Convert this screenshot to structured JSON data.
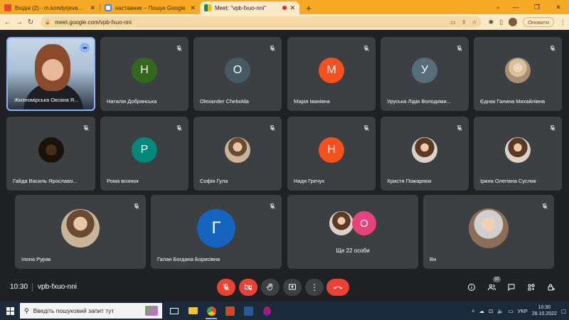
{
  "browser": {
    "tabs": [
      {
        "label": "Вхідні (2) - m.kondyrjeva@ippo.kubg...",
        "favicon_color": "#ea4335",
        "active": false
      },
      {
        "label": "наставник – Пошук Google",
        "favicon_color": "#4285f4",
        "active": false
      },
      {
        "label": "Meet: \"vpb-fxuo-nni\"",
        "favicon_color": "#00897b",
        "active": true
      }
    ],
    "url": "meet.google.com/vpb-fxuo-nni",
    "update_label": "Оновити",
    "theme_color": "#f6a925"
  },
  "meet": {
    "self_tile": {
      "name": "Жизномірська Оксана Я..."
    },
    "participants": [
      {
        "name": "Наталія Добрянська",
        "initial": "Н",
        "color": "#33691e",
        "kind": "letter"
      },
      {
        "name": "Olexander Chebolda",
        "initial": "O",
        "color": "#455a64",
        "kind": "letter"
      },
      {
        "name": "Марія Іванівна",
        "initial": "М",
        "color": "#f4511e",
        "kind": "letter"
      },
      {
        "name": "Уруська Лідія Володими...",
        "initial": "У",
        "color": "#546e7a",
        "kind": "letter"
      },
      {
        "name": "Єднак Галина Михайлівна",
        "initial": "",
        "color": "",
        "kind": "photo2"
      },
      {
        "name": "Гайда Василь Ярославо...",
        "initial": "",
        "color": "",
        "kind": "photo3"
      },
      {
        "name": "Рома вознюк",
        "initial": "Р",
        "color": "#00897b",
        "kind": "letter"
      },
      {
        "name": "Софія Гула",
        "initial": "",
        "color": "",
        "kind": "photo"
      },
      {
        "name": "Надя Гречух",
        "initial": "Н",
        "color": "#f4511e",
        "kind": "letter"
      },
      {
        "name": "Христя Пожарнюк",
        "initial": "",
        "color": "",
        "kind": "photo4"
      },
      {
        "name": "Ірина Олегівна Суслик",
        "initial": "",
        "color": "",
        "kind": "photo4"
      },
      {
        "name": "Ілона Рурак",
        "initial": "",
        "color": "",
        "kind": "photo"
      },
      {
        "name": "Галан Богдана Борисівна",
        "initial": "Г",
        "color": "#1565c0",
        "kind": "letter"
      }
    ],
    "others": {
      "label": "Ще 22 особи",
      "initial": "O",
      "color": "#e8437a"
    },
    "you": {
      "name": "Ви"
    },
    "time": "10:30",
    "meeting_code": "vpb-fxuo-nni",
    "participant_count": "37"
  },
  "taskbar": {
    "search_placeholder": "Введіть пошуковий запит тут",
    "language": "УКР",
    "time": "10:30",
    "date": "28.10.2022"
  }
}
